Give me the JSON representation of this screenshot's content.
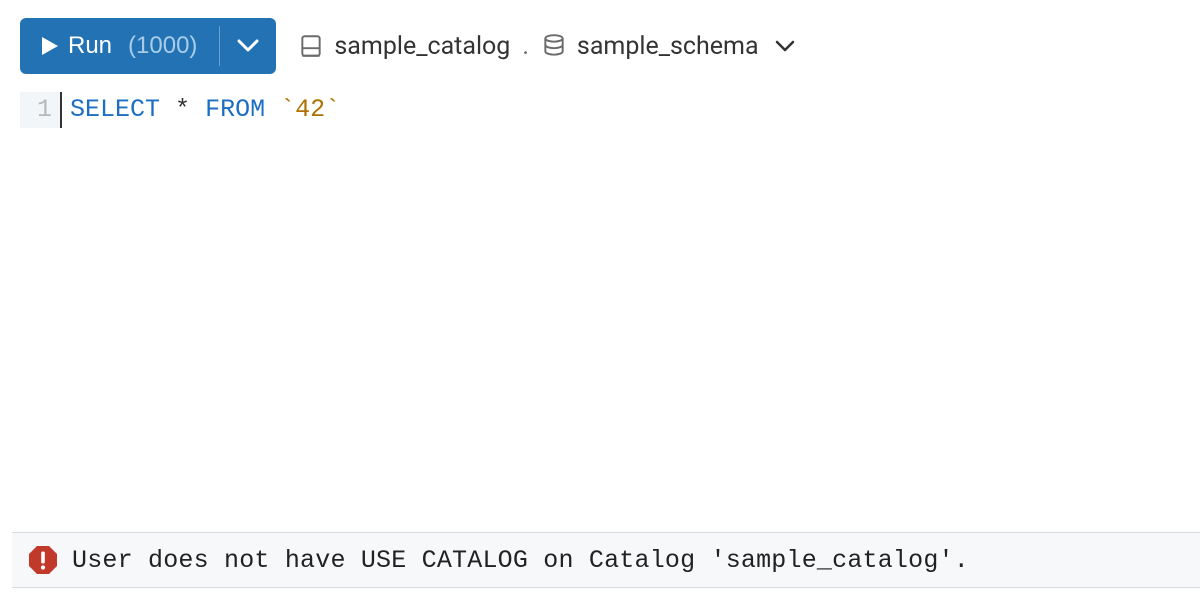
{
  "toolbar": {
    "run_label": "Run",
    "run_limit": "(1000)",
    "catalog_name": "sample_catalog",
    "schema_name": "sample_schema"
  },
  "editor": {
    "line_number": "1",
    "kw_select": "SELECT",
    "kw_star": "*",
    "kw_from": "FROM",
    "ident": "`42`"
  },
  "error": {
    "message": "User does not have USE CATALOG on Catalog 'sample_catalog'."
  }
}
